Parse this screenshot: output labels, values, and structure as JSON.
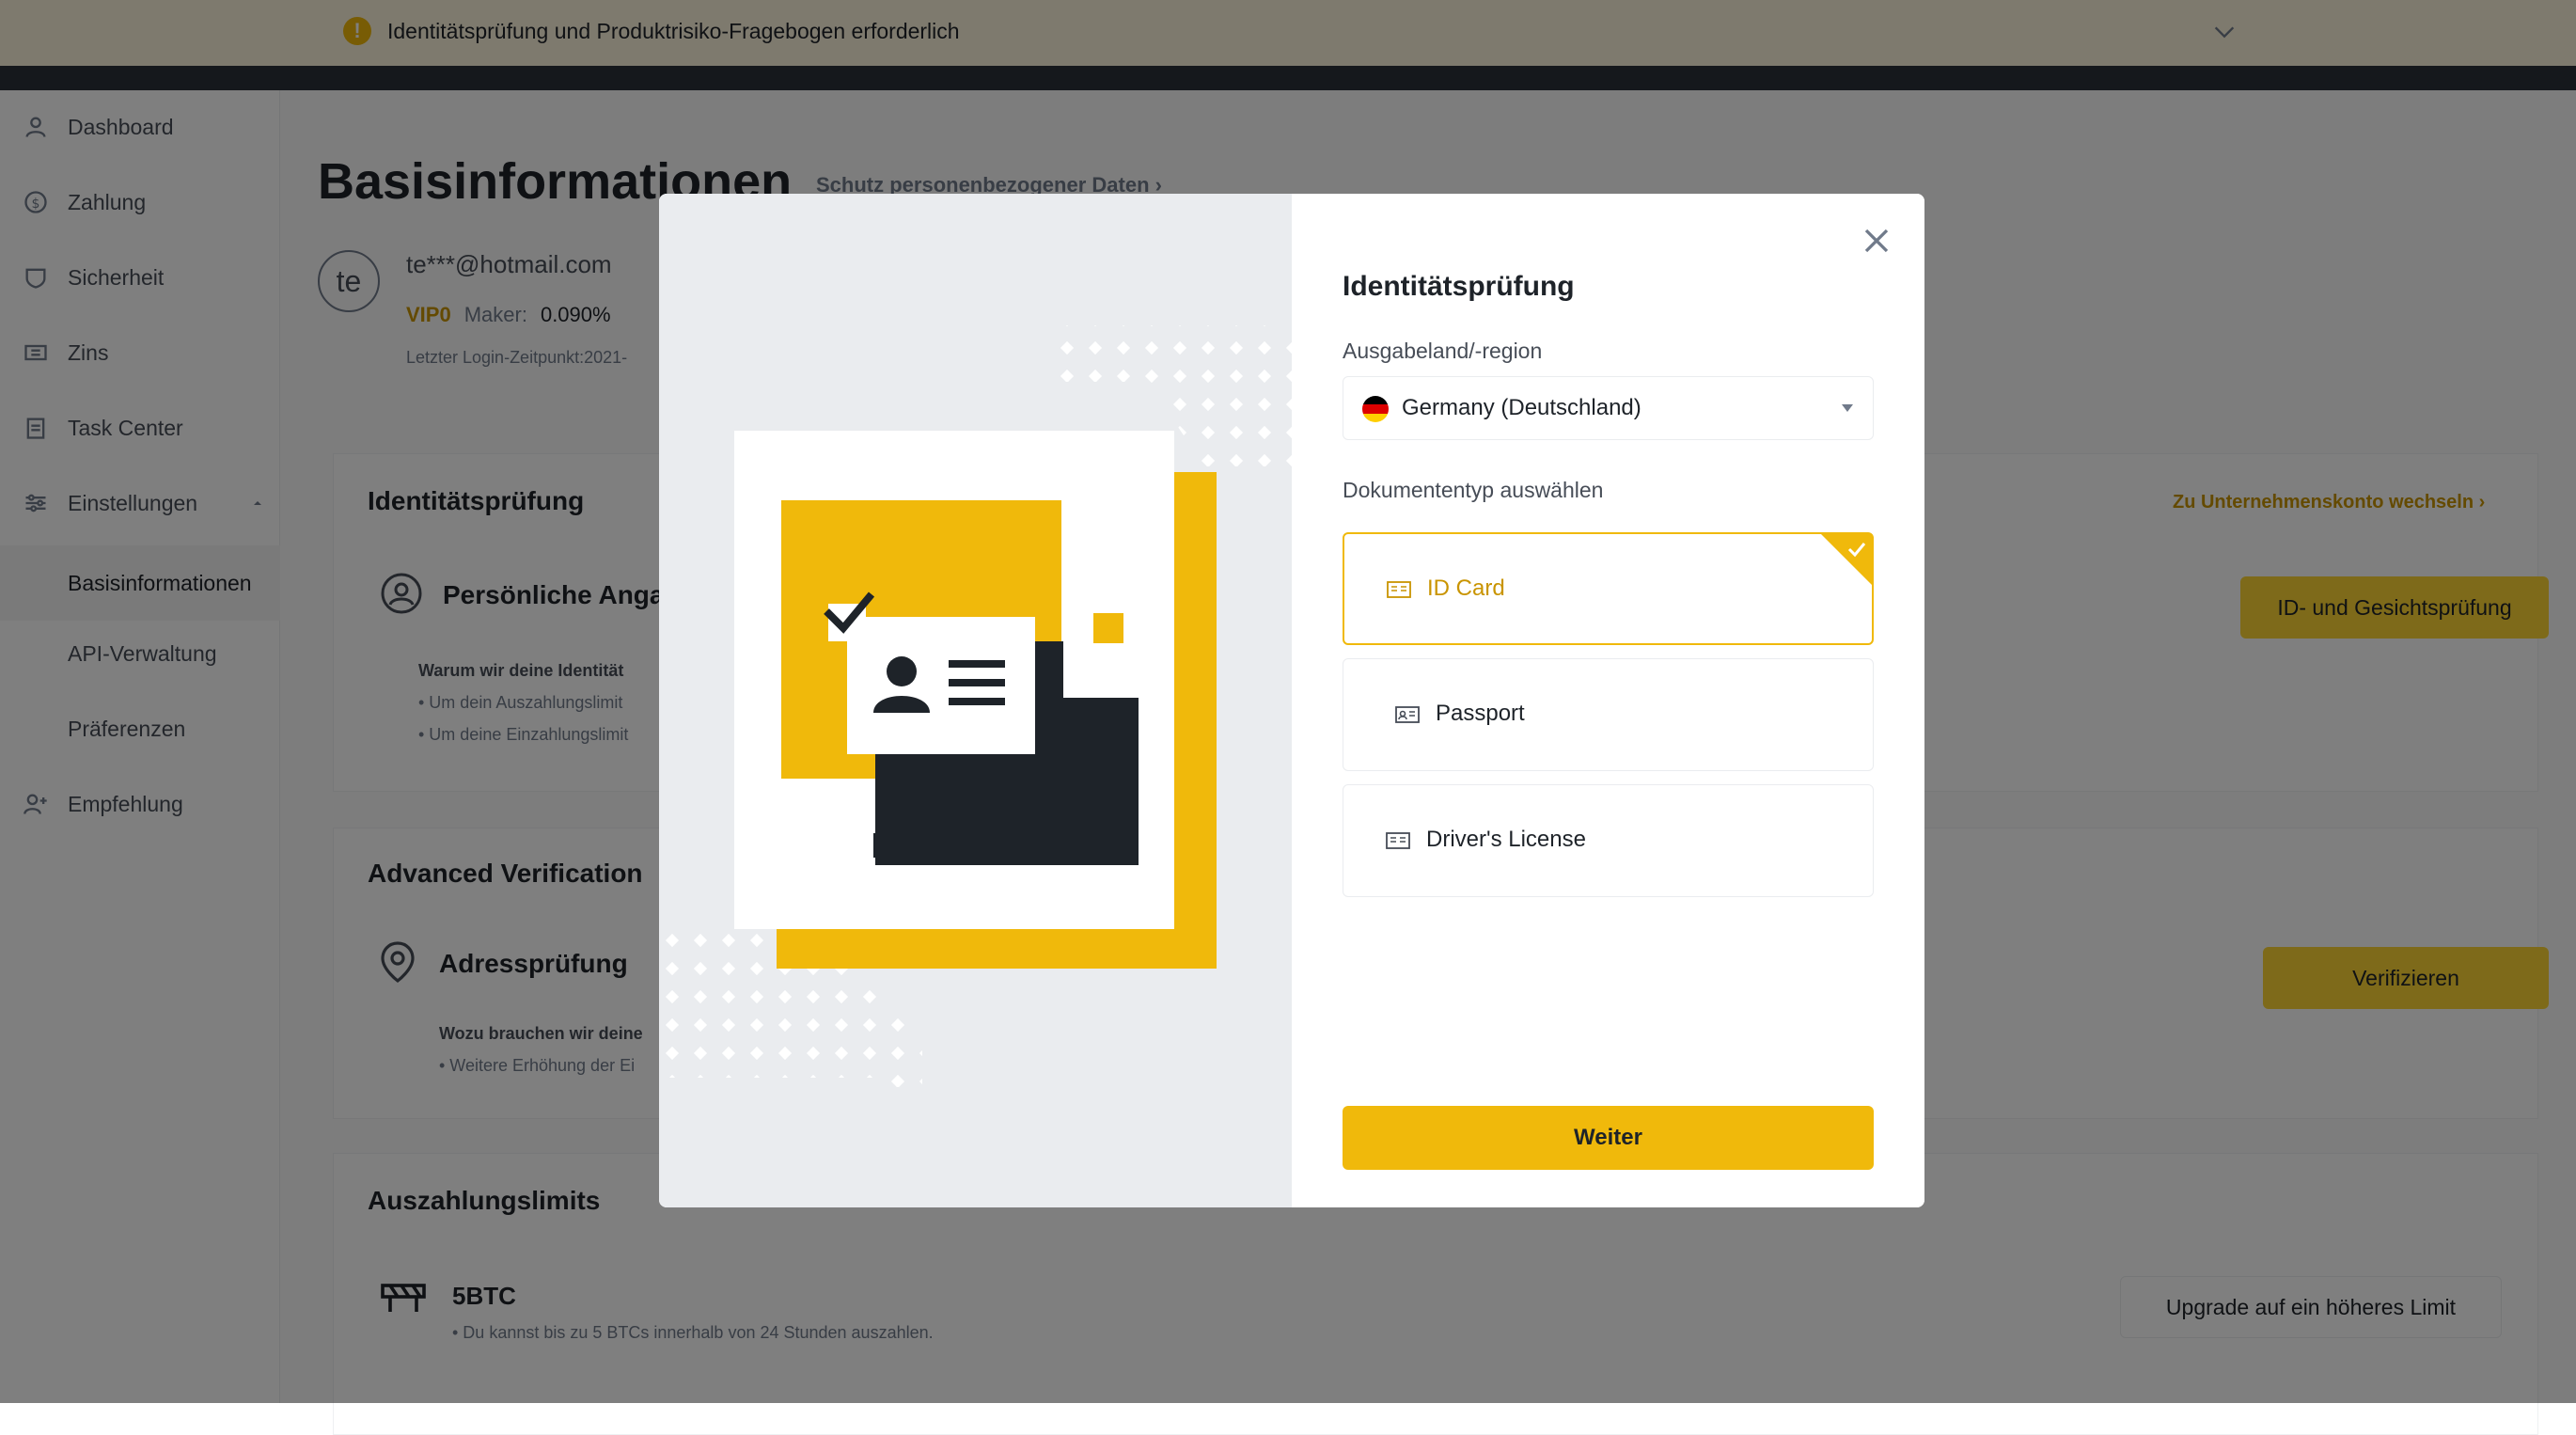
{
  "banner": {
    "text": "Identitätsprüfung und Produktrisiko-Fragebogen erforderlich",
    "warn_icon": "!"
  },
  "sidebar": {
    "items": [
      {
        "label": "Dashboard",
        "icon": "user-icon"
      },
      {
        "label": "Zahlung",
        "icon": "dollar-icon"
      },
      {
        "label": "Sicherheit",
        "icon": "shield-icon"
      },
      {
        "label": "Zins",
        "icon": "ticket-icon"
      },
      {
        "label": "Task Center",
        "icon": "clipboard-icon"
      },
      {
        "label": "Einstellungen",
        "icon": "sliders-icon"
      },
      {
        "label": "Empfehlung",
        "icon": "user-plus-icon"
      }
    ],
    "sub_items": [
      {
        "label": "Basisinformationen"
      },
      {
        "label": "API-Verwaltung"
      },
      {
        "label": "Präferenzen"
      }
    ]
  },
  "main": {
    "title": "Basisinformationen",
    "privacy_link": "Schutz personenbezogener Daten",
    "avatar": "te",
    "email": "te***@hotmail.com",
    "vip": "VIP0",
    "maker_label": "Maker:",
    "maker_value": "0.090%",
    "last_login": "Letzter Login-Zeitpunkt:2021-",
    "identity": {
      "title": "Identitätsprüfung",
      "switch_link": "Zu Unternehmenskonto wechseln",
      "personal": "Persönliche Angab",
      "why": "Warum wir deine Identität",
      "bullet1": "• Um dein Auszahlungslimit",
      "bullet2": "• Um deine Einzahlungslimit",
      "button": "ID- und Gesichtsprüfung"
    },
    "advanced": {
      "title": "Advanced Verification",
      "address": "Adressprüfung",
      "why": "Wozu brauchen wir deine",
      "bullet": "• Weitere Erhöhung der Ei",
      "button": "Verifizieren"
    },
    "limits": {
      "title": "Auszahlungslimits",
      "amount": "5BTC",
      "desc": "• Du kannst bis zu 5 BTCs innerhalb von 24 Stunden auszahlen.",
      "button": "Upgrade auf ein höheres Limit"
    }
  },
  "modal": {
    "title": "Identitätsprüfung",
    "country_label": "Ausgabeland/-region",
    "country_value": "Germany (Deutschland)",
    "doc_label": "Dokumententyp auswählen",
    "options": [
      {
        "label": "ID Card",
        "selected": true
      },
      {
        "label": "Passport",
        "selected": false
      },
      {
        "label": "Driver's License",
        "selected": false
      }
    ],
    "continue": "Weiter"
  },
  "colors": {
    "brand_yellow": "#f0b90b",
    "overlay": "rgba(0,0,0,0.5)"
  }
}
